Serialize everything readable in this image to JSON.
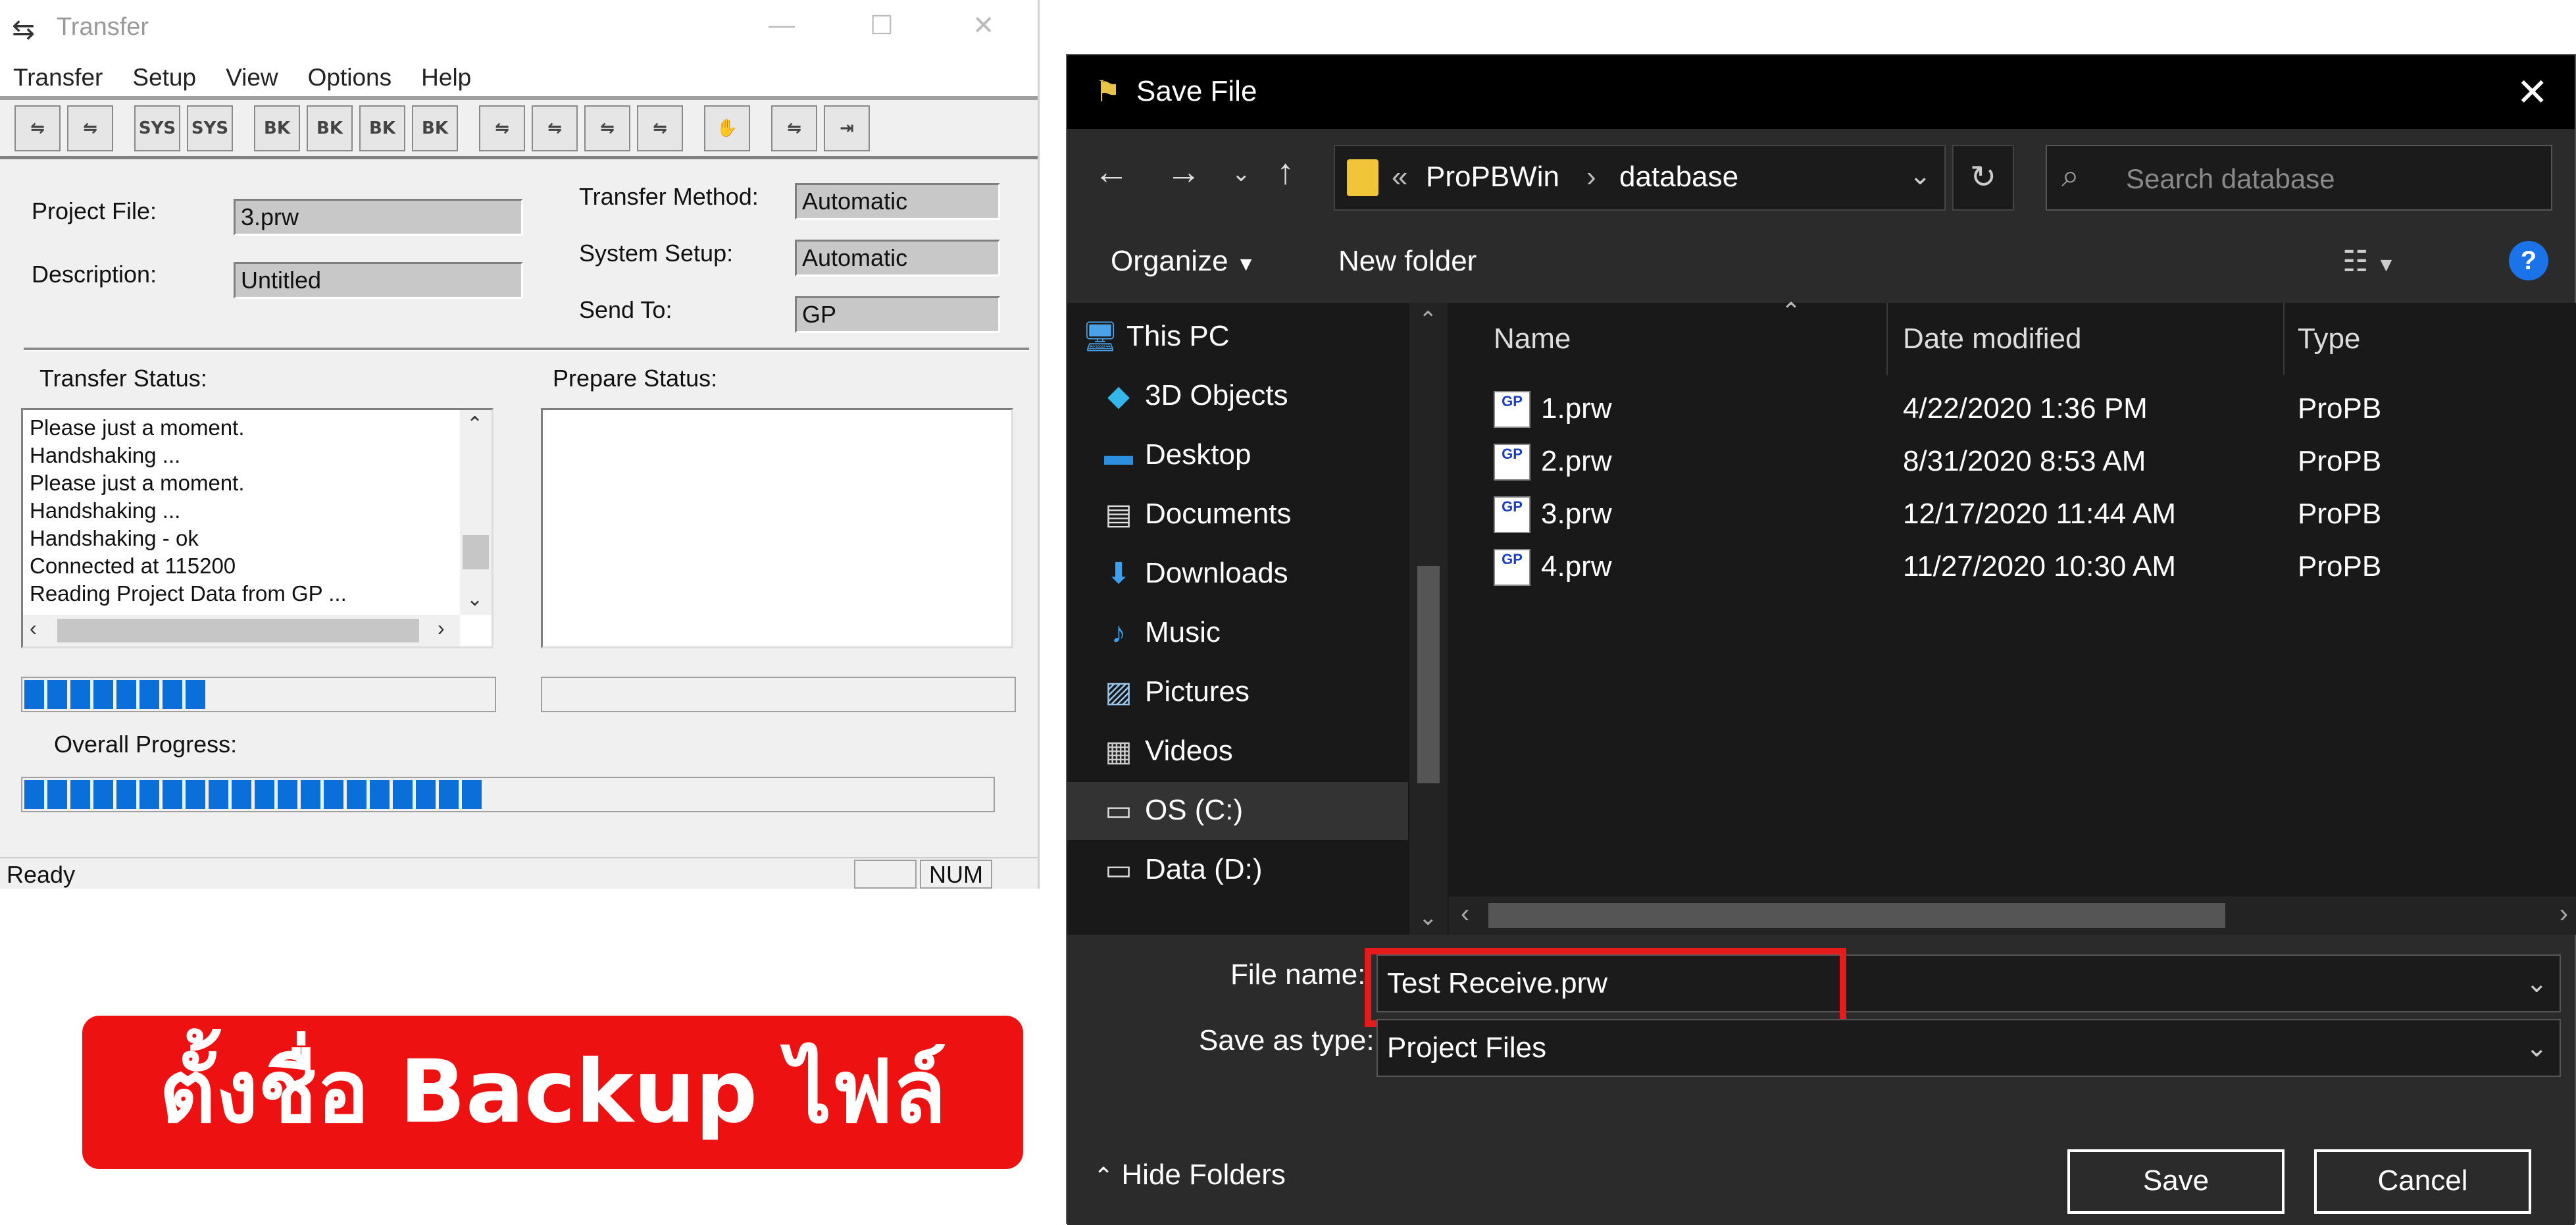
{
  "transfer_window": {
    "title": "Transfer",
    "menu": [
      "Transfer",
      "Setup",
      "View",
      "Options",
      "Help"
    ],
    "toolbar_icons": [
      "send-icon",
      "receive-icon",
      "sys-send-icon",
      "sys-receive-icon",
      "bk-send-icon",
      "bk-receive-icon",
      "bk-compare-icon",
      "bk-verify-icon",
      "tool-a-icon",
      "tool-b-icon",
      "tool-c-icon",
      "tool-d-icon",
      "hand-stop-icon",
      "tool-e-icon",
      "exit-icon"
    ],
    "toolbar_labels": [
      "",
      "",
      "SYS",
      "SYS",
      "BK",
      "BK",
      "BK",
      "BK",
      "",
      "",
      "",
      "",
      "",
      "",
      ""
    ],
    "project_file_label": "Project File:",
    "project_file_value": "3.prw",
    "description_label": "Description:",
    "description_value": "Untitled",
    "transfer_method_label": "Transfer Method:",
    "transfer_method_value": "Automatic",
    "system_setup_label": "System Setup:",
    "system_setup_value": "Automatic",
    "send_to_label": "Send To:",
    "send_to_value": "GP",
    "transfer_status_label": "Transfer Status:",
    "prepare_status_label": "Prepare Status:",
    "status_lines": [
      "Please just a moment.",
      "Handshaking ...",
      "Please just a moment.",
      "Handshaking ...",
      "Handshaking - ok",
      "Connected at 115200",
      "Reading Project Data from GP ..."
    ],
    "transfer_progress": 0.4,
    "prepare_progress": 0.0,
    "overall_progress_label": "Overall Progress:",
    "overall_progress": 0.5,
    "status_text": "Ready",
    "num_indicator": "NUM"
  },
  "save_dialog": {
    "title": "Save File",
    "breadcrumb": [
      "ProPBWin",
      "database"
    ],
    "search_placeholder": "Search database",
    "organize_label": "Organize",
    "new_folder_label": "New folder",
    "nav_items": [
      "This PC",
      "3D Objects",
      "Desktop",
      "Documents",
      "Downloads",
      "Music",
      "Pictures",
      "Videos",
      "OS (C:)",
      "Data (D:)"
    ],
    "nav_icons": [
      "computer-icon",
      "cube-icon",
      "desktop-icon",
      "document-icon",
      "download-icon",
      "music-icon",
      "pictures-icon",
      "videos-icon",
      "drive-icon",
      "drive-icon"
    ],
    "columns": [
      "Name",
      "Date modified",
      "Type"
    ],
    "files": [
      {
        "name": "1.prw",
        "date": "4/22/2020 1:36 PM",
        "type": "ProPB"
      },
      {
        "name": "2.prw",
        "date": "8/31/2020 8:53 AM",
        "type": "ProPB"
      },
      {
        "name": "3.prw",
        "date": "12/17/2020 11:44 AM",
        "type": "ProPB"
      },
      {
        "name": "4.prw",
        "date": "11/27/2020 10:30 AM",
        "type": "ProPB"
      }
    ],
    "file_icon_text": "GP",
    "file_name_label": "File name:",
    "file_name_value": "Test Receive.prw",
    "save_as_type_label": "Save as type:",
    "save_as_type_value": "Project Files",
    "hide_folders_label": "Hide Folders",
    "save_button": "Save",
    "cancel_button": "Cancel"
  },
  "banner_text": "ตั้งชื่อ Backup ไฟล์",
  "colors": {
    "accent_blue": "#0a6fd8",
    "highlight_red": "#e61b1b",
    "banner_red": "#ee1111",
    "dialog_bg": "#1f1f1f"
  }
}
